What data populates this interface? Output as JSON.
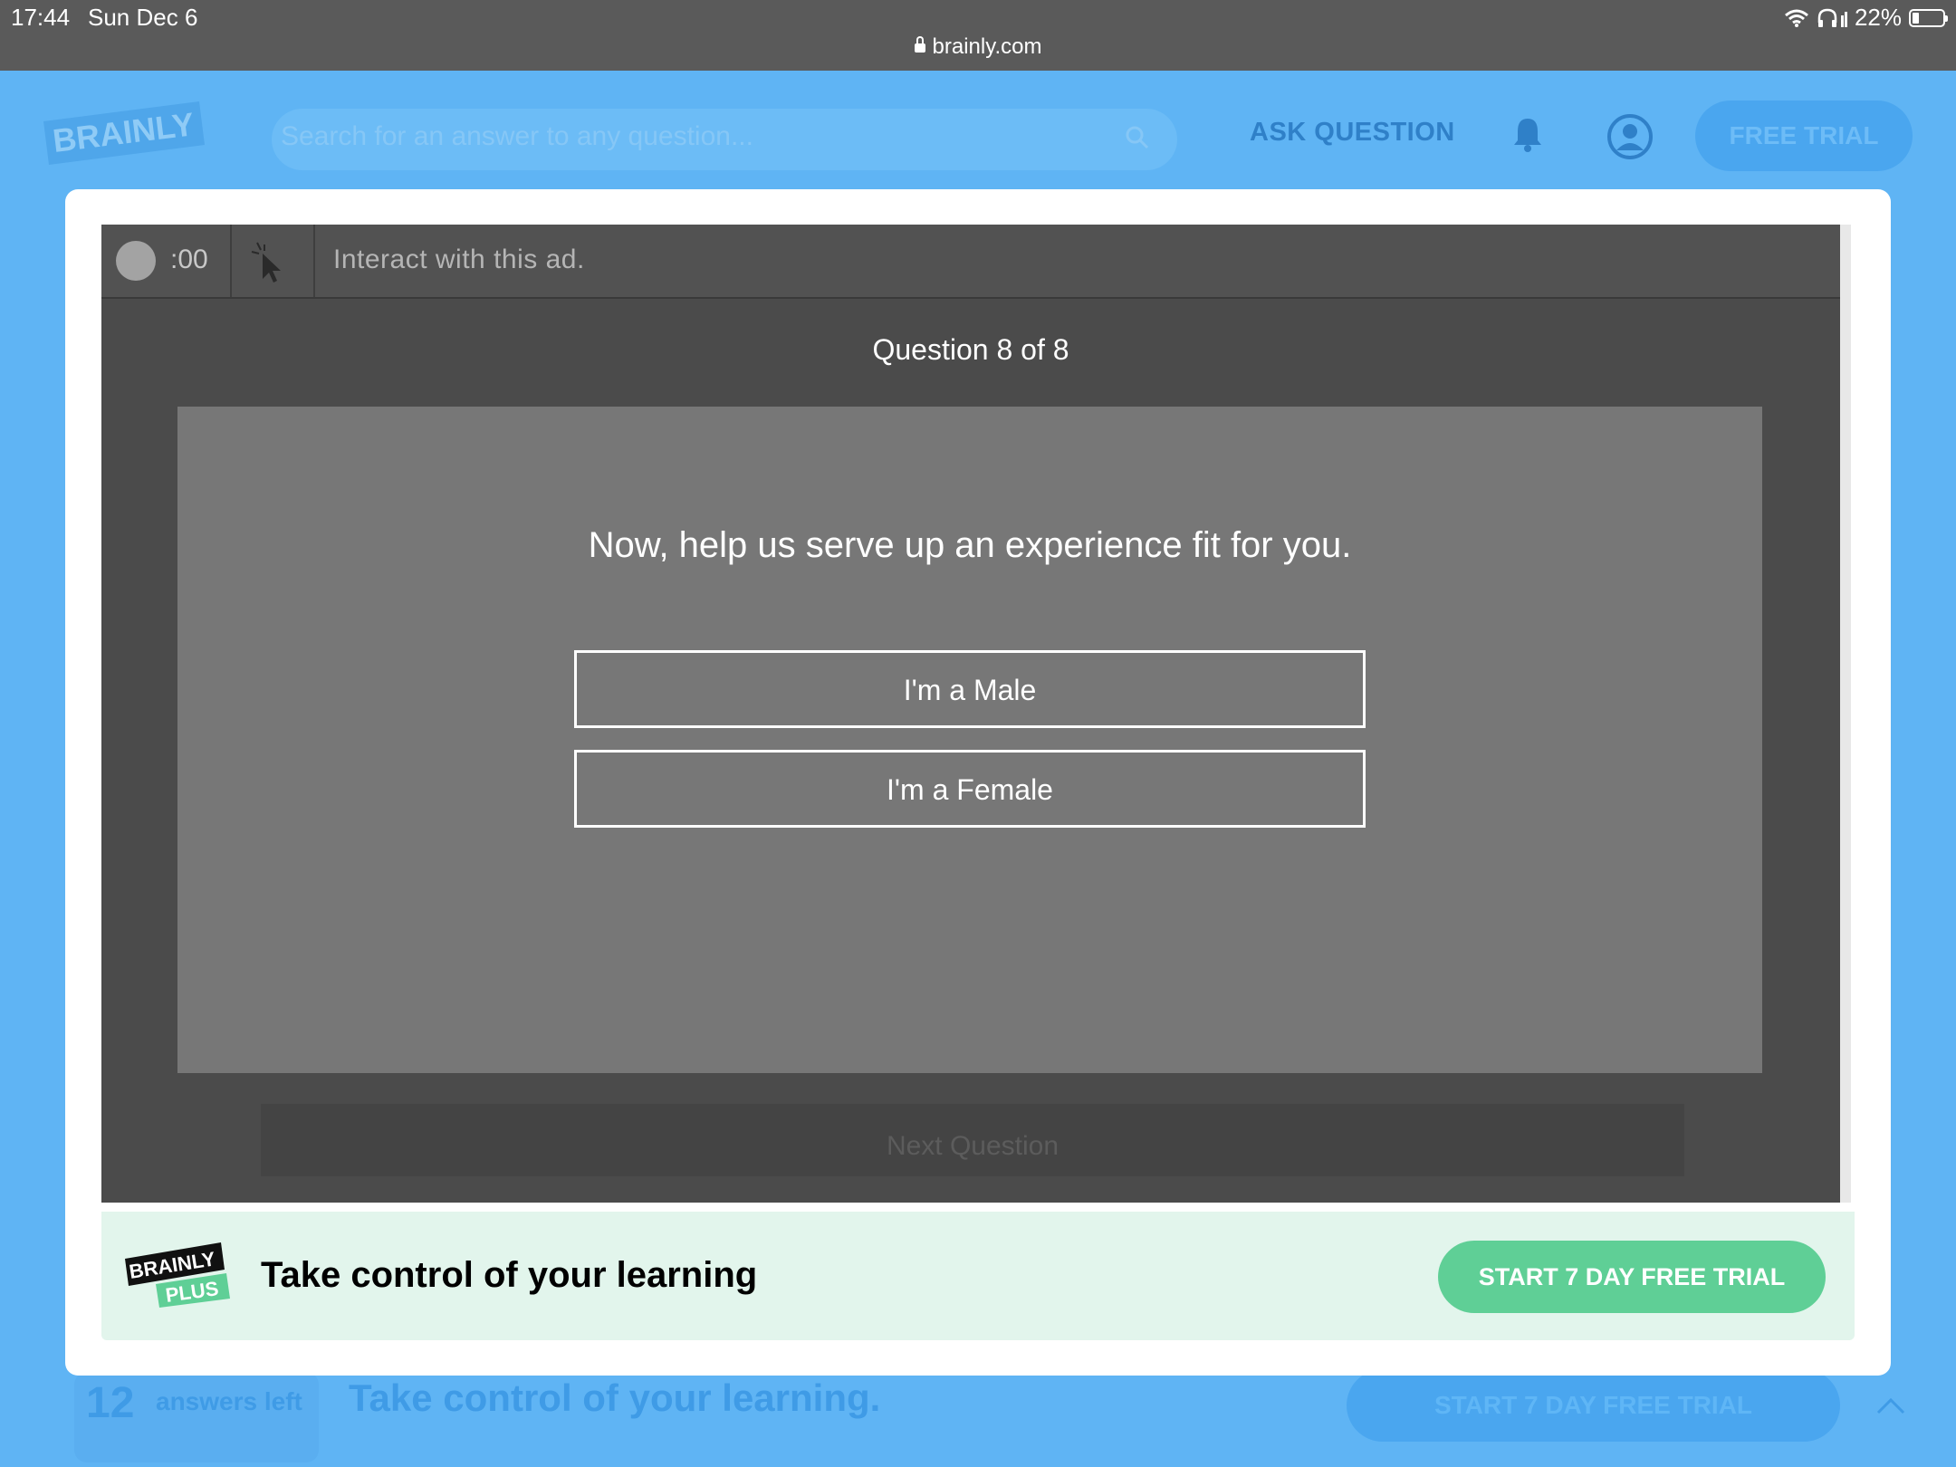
{
  "status_bar": {
    "time": "17:44",
    "date": "Sun Dec 6",
    "url": "brainly.com",
    "battery": "22%"
  },
  "header": {
    "logo_text": "BRAINLY",
    "search_placeholder": "Search for an answer to any question...",
    "ask_question": "ASK QUESTION",
    "free_trial": "FREE TRIAL"
  },
  "background_footer": {
    "answers_count": "12",
    "answers_label": "answers left",
    "tagline": "Take control of your learning.",
    "cta": "START 7 DAY FREE TRIAL"
  },
  "ad": {
    "timer": ":00",
    "instruction": "Interact with this ad.",
    "question_count": "Question 8 of 8",
    "question": "Now, help us serve up an experience fit for you.",
    "options": [
      "I'm a Male",
      "I'm a Female"
    ],
    "next_label": "Next Question"
  },
  "plus_banner": {
    "logo_top": "BRAINLY",
    "logo_bottom": "PLUS",
    "tagline": "Take control of your learning",
    "cta": "START 7 DAY FREE TRIAL"
  },
  "colors": {
    "page_bg": "#5fb4f4",
    "plus_green": "#5fcf96",
    "ad_dark": "#4b4b4b",
    "panel_gray": "#777777"
  }
}
